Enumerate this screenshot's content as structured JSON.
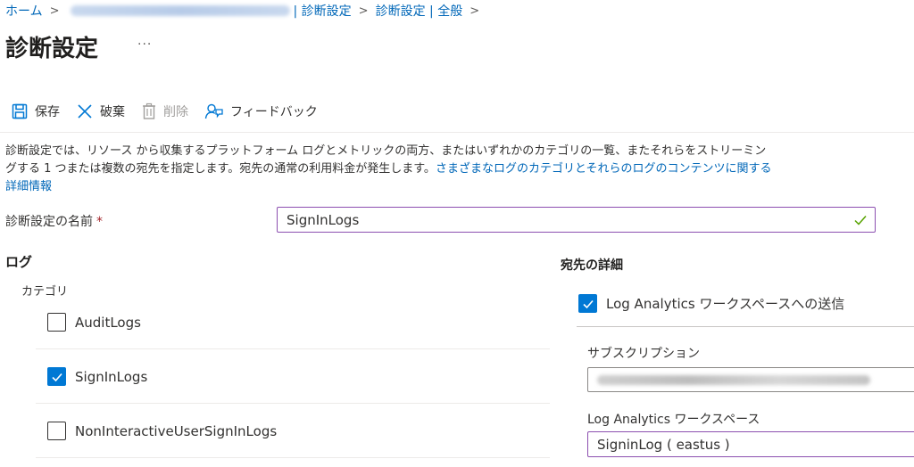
{
  "breadcrumb": {
    "home": "ホーム",
    "resource_redacted": "",
    "crumb2": "| 診断設定",
    "crumb3": "診断設定 | 全般"
  },
  "page": {
    "title": "診断設定",
    "more": "···"
  },
  "toolbar": {
    "save": "保存",
    "discard": "破棄",
    "delete": "削除",
    "feedback": "フィードバック"
  },
  "description": {
    "text": "診断設定では、リソース から収集するプラットフォーム ログとメトリックの両方、またはいずれかのカテゴリの一覧、またそれらをストリーミングする 1 つまたは複数の宛先を指定します。宛先の通常の利用料金が発生します。",
    "link": "さまざまなログのカテゴリとそれらのログのコンテンツに関する詳細情報"
  },
  "name_field": {
    "label": "診断設定の名前",
    "required_mark": "*",
    "value": "SignInLogs"
  },
  "logs": {
    "heading": "ログ",
    "category_label": "カテゴリ",
    "items": [
      {
        "label": "AuditLogs",
        "checked": false
      },
      {
        "label": "SignInLogs",
        "checked": true
      },
      {
        "label": "NonInteractiveUserSignInLogs",
        "checked": false
      }
    ]
  },
  "destination": {
    "heading": "宛先の詳細",
    "log_analytics": {
      "label": "Log Analytics ワークスペースへの送信",
      "checked": true
    },
    "subscription_label": "サブスクリプション",
    "workspace_label": "Log Analytics ワークスペース",
    "workspace_value": "SigninLog ( eastus )"
  },
  "colors": {
    "link": "#0067b8",
    "accent": "#0078d4",
    "focus_border": "#8c4fb0",
    "valid_check": "#57a300",
    "required": "#a4262c"
  },
  "icons": {
    "save": "save-icon",
    "discard": "close-icon",
    "delete": "trash-icon",
    "feedback": "feedback-icon",
    "valid": "checkmark-icon",
    "chevron": "chevron-right-icon"
  }
}
